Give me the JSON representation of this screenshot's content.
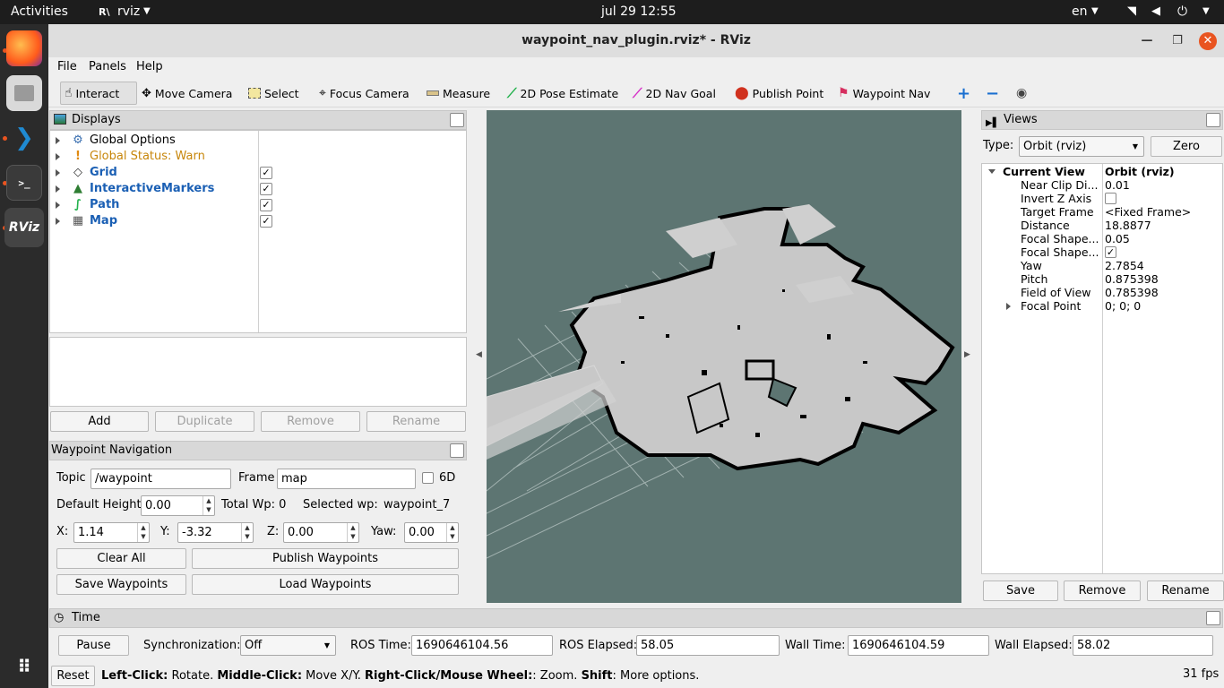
{
  "topbar": {
    "activities": "Activities",
    "app": "rviz",
    "clock": "jul 29  12:55",
    "lang": "en"
  },
  "dock": {
    "apps": [
      "firefox-icon",
      "files-icon",
      "vscode-icon",
      "terminal-icon",
      "rviz-icon"
    ],
    "rviz_label": "RViz"
  },
  "window": {
    "title": "waypoint_nav_plugin.rviz* - RViz"
  },
  "menu": {
    "file": "File",
    "panels": "Panels",
    "help": "Help"
  },
  "toolbar": {
    "interact": "Interact",
    "move_camera": "Move Camera",
    "select": "Select",
    "focus_camera": "Focus Camera",
    "measure": "Measure",
    "pose_estimate": "2D Pose Estimate",
    "nav_goal": "2D Nav Goal",
    "publish_point": "Publish Point",
    "waypoint_nav": "Waypoint Nav"
  },
  "displays": {
    "title": "Displays",
    "items": [
      {
        "label": "Global Options",
        "checked": false,
        "color": "#000000"
      },
      {
        "label": "Global Status: Warn",
        "checked": false,
        "color": "#c7860a"
      },
      {
        "label": "Grid",
        "checked": true,
        "color": "#1a5fb4"
      },
      {
        "label": "InteractiveMarkers",
        "checked": true,
        "color": "#1a5fb4"
      },
      {
        "label": "Path",
        "checked": true,
        "color": "#1a5fb4"
      },
      {
        "label": "Map",
        "checked": true,
        "color": "#1a5fb4"
      }
    ],
    "add": "Add",
    "duplicate": "Duplicate",
    "remove": "Remove",
    "rename": "Rename"
  },
  "waypoint": {
    "title": "Waypoint Navigation",
    "topic_label": "Topic",
    "topic_value": "/waypoint",
    "frame_label": "Frame",
    "frame_value": "map",
    "six_d": "6D",
    "default_height_label": "Default Height",
    "default_height_value": "0.00",
    "total_wp": "Total Wp: 0",
    "selected_wp_label": "Selected wp:",
    "selected_wp_value": "waypoint_7",
    "x_label": "X:",
    "x_value": "1.14",
    "y_label": "Y:",
    "y_value": "-3.32",
    "z_label": "Z:",
    "z_value": "0.00",
    "yaw_label": "Yaw:",
    "yaw_value": "0.00",
    "clear_all": "Clear All",
    "publish": "Publish Waypoints",
    "save": "Save Waypoints",
    "load": "Load Waypoints"
  },
  "views": {
    "title": "Views",
    "type_label": "Type:",
    "type_value": "Orbit (rviz)",
    "zero": "Zero",
    "current_view": "Current View",
    "current_view_value": "Orbit (rviz)",
    "props": [
      {
        "name": "Near Clip Di...",
        "value": "0.01"
      },
      {
        "name": "Invert Z Axis",
        "value": ""
      },
      {
        "name": "Target Frame",
        "value": "<Fixed Frame>"
      },
      {
        "name": "Distance",
        "value": "18.8877"
      },
      {
        "name": "Focal Shape...",
        "value": "0.05"
      },
      {
        "name": "Focal Shape...",
        "value": "✓"
      },
      {
        "name": "Yaw",
        "value": "2.7854"
      },
      {
        "name": "Pitch",
        "value": "0.875398"
      },
      {
        "name": "Field of View",
        "value": "0.785398"
      },
      {
        "name": "Focal Point",
        "value": "0; 0; 0"
      }
    ],
    "save": "Save",
    "remove": "Remove",
    "rename": "Rename"
  },
  "time": {
    "title": "Time",
    "pause": "Pause",
    "sync_label": "Synchronization:",
    "sync_value": "Off",
    "ros_time_label": "ROS Time:",
    "ros_time": "1690646104.56",
    "ros_elapsed_label": "ROS Elapsed:",
    "ros_elapsed": "58.05",
    "wall_time_label": "Wall Time:",
    "wall_time": "1690646104.59",
    "wall_elapsed_label": "Wall Elapsed:",
    "wall_elapsed": "58.02"
  },
  "status": {
    "reset": "Reset",
    "lc": "Left-Click:",
    "lc_t": " Rotate. ",
    "mc": "Middle-Click:",
    "mc_t": " Move X/Y. ",
    "rc": "Right-Click/Mouse Wheel:",
    "rc_t": ": Zoom. ",
    "sh": "Shift",
    "sh_t": ": More options.",
    "fps": "31 fps"
  },
  "colors": {
    "viewport_bg": "#5d7572",
    "map_free": "#c8c8c8",
    "map_wall": "#000000",
    "grid": "#a0b0ae"
  }
}
